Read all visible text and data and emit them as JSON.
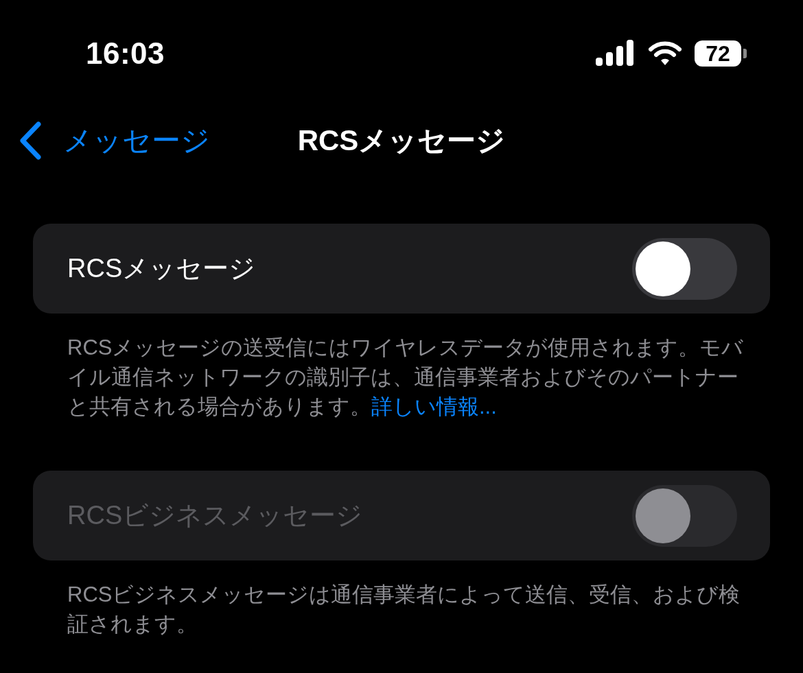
{
  "status_bar": {
    "time": "16:03",
    "battery": "72"
  },
  "nav": {
    "back_label": "メッセージ",
    "title": "RCSメッセージ"
  },
  "sections": [
    {
      "label": "RCSメッセージ",
      "on": false,
      "disabled": false,
      "footer": "RCSメッセージの送受信にはワイヤレスデータが使用されます。モバイル通信ネットワークの識別子は、通信事業者およびそのパートナーと共有される場合があります。",
      "footer_link": "詳しい情報..."
    },
    {
      "label": "RCSビジネスメッセージ",
      "on": false,
      "disabled": true,
      "footer": "RCSビジネスメッセージは通信事業者によって送信、受信、および検証されます。"
    }
  ]
}
